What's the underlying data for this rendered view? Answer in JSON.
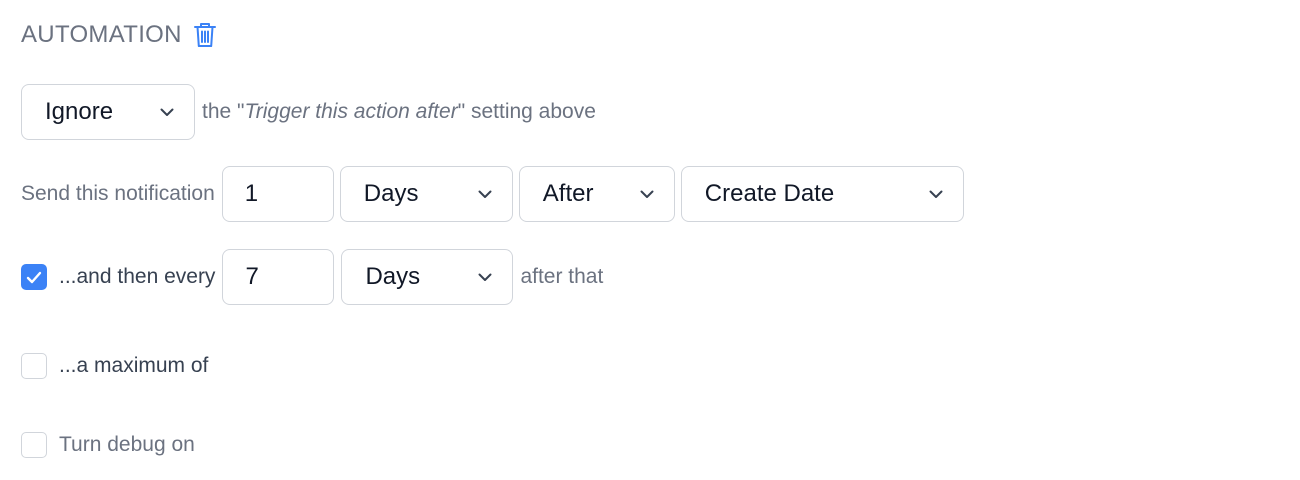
{
  "header": {
    "title": "AUTOMATION",
    "delete_icon": "trash-icon"
  },
  "ignore_row": {
    "select_value": "Ignore",
    "text_before": "the \"",
    "text_italic": "Trigger this action after",
    "text_after": "\" setting above"
  },
  "send_row": {
    "label": "Send this notification",
    "amount": "1",
    "unit": "Days",
    "direction": "After",
    "field": "Create Date"
  },
  "repeat_row": {
    "checked": true,
    "label": "...and then every",
    "amount": "7",
    "unit": "Days",
    "suffix": "after that"
  },
  "maximum_row": {
    "checked": false,
    "label": "...a maximum of"
  },
  "debug_row": {
    "checked": false,
    "label": "Turn debug on"
  },
  "colors": {
    "accent": "#3b82f6",
    "border": "#d1d5db",
    "muted_text": "#6b7280"
  }
}
